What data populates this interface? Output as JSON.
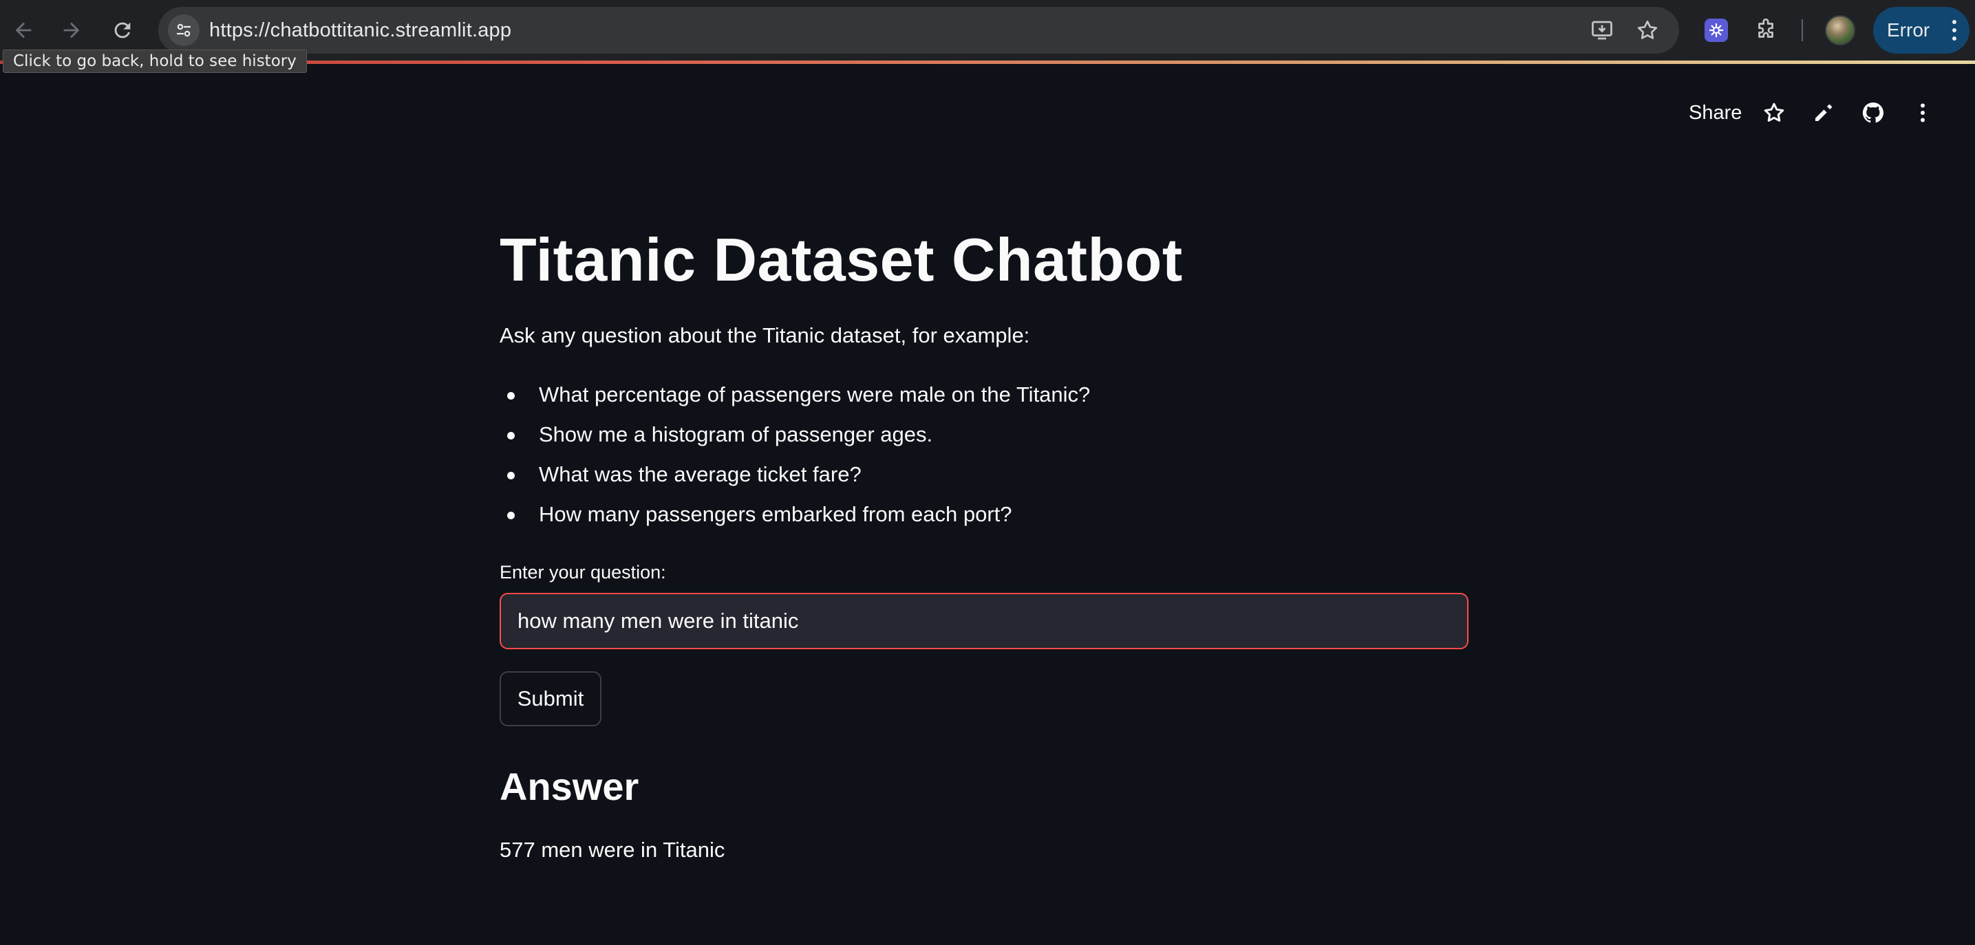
{
  "browser": {
    "url": "https://chatbottitanic.streamlit.app",
    "tooltip": "Click to go back, hold to see history",
    "profile_status": "Error",
    "icons": [
      "back-arrow-icon",
      "forward-arrow-icon",
      "reload-icon",
      "site-settings-icon",
      "install-app-icon",
      "bookmark-star-icon",
      "extension-icon",
      "puzzle-extensions-icon",
      "avatar",
      "kebab-menu-icon"
    ]
  },
  "app_header": {
    "share_label": "Share",
    "icons": [
      "star-icon",
      "edit-pencil-icon",
      "github-icon",
      "kebab-menu-icon"
    ]
  },
  "main": {
    "title": "Titanic Dataset Chatbot",
    "intro": "Ask any question about the Titanic dataset, for example:",
    "examples": [
      "What percentage of passengers were male on the Titanic?",
      "Show me a histogram of passenger ages.",
      "What was the average ticket fare?",
      "How many passengers embarked from each port?"
    ],
    "question_label": "Enter your question:",
    "question_value": "how many men were in titanic",
    "submit_label": "Submit",
    "answer_heading": "Answer",
    "answer_text": "577 men were in Titanic"
  },
  "colors": {
    "background": "#0e1117",
    "input_background": "#262730",
    "input_focus_border": "#ff4b4b",
    "text": "#fafafa",
    "browser_chrome": "#202124",
    "omnibox": "#35363a",
    "error_pill": "#10466f"
  }
}
